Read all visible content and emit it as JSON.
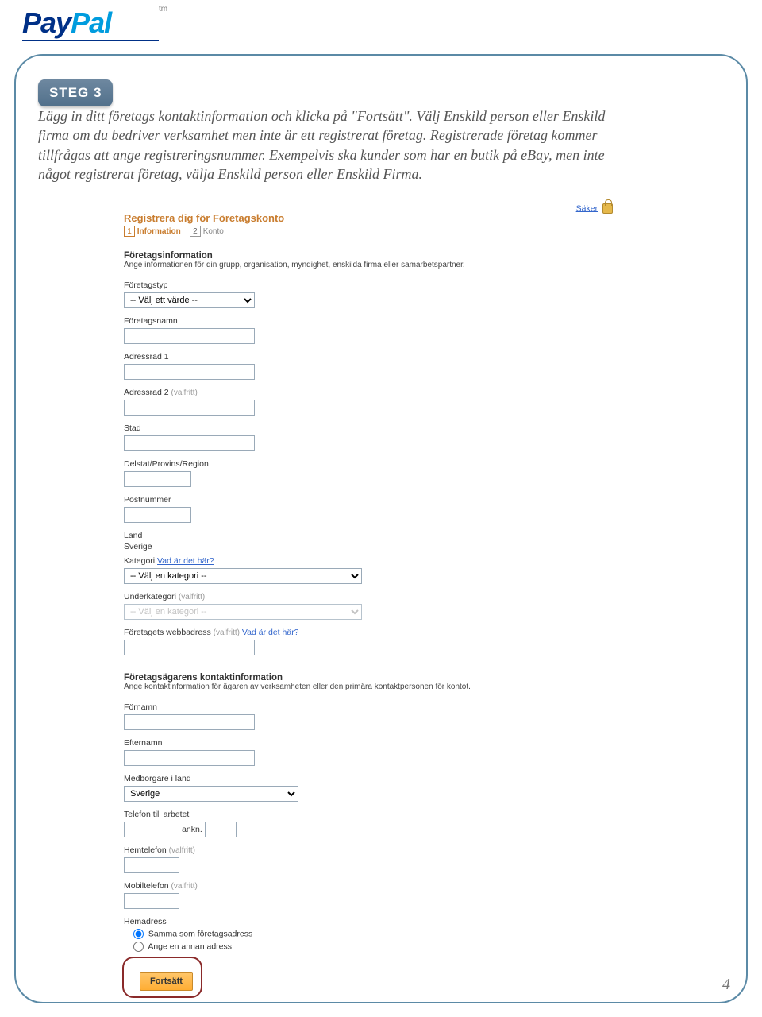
{
  "logo": {
    "part1": "Pay",
    "part2": "Pal",
    "tm": "tm"
  },
  "step_badge": "STEG 3",
  "intro": "Lägg in ditt företags kontaktinformation och klicka på \"Fortsätt\". Välj Enskild person eller Enskild firma om du bedriver verksamhet men inte är ett registrerat företag. Registrerade företag kommer tillfrågas att ange registreringsnummer. Exempelvis ska kunder som har en butik på eBay, men inte något registrerat företag, välja Enskild person eller Enskild Firma.",
  "form": {
    "title": "Registrera dig för Företagskonto",
    "secure_label": "Säker",
    "steps": {
      "n1": "1",
      "lbl1": "Information",
      "n2": "2",
      "lbl2": "Konto"
    },
    "company": {
      "heading": "Företagsinformation",
      "desc": "Ange informationen för din grupp, organisation, myndighet, enskilda firma eller samarbetspartner.",
      "type_label": "Företagstyp",
      "type_option": "-- Välj ett värde --",
      "name_label": "Företagsnamn",
      "addr1_label": "Adressrad 1",
      "addr2_label": "Adressrad 2",
      "addr2_opt": "(valfritt)",
      "city_label": "Stad",
      "region_label": "Delstat/Provins/Region",
      "postal_label": "Postnummer",
      "country_label": "Land",
      "country_value": "Sverige",
      "category_label": "Kategori",
      "category_help": "Vad är det här?",
      "category_option": "-- Välj en kategori --",
      "subcategory_label": "Underkategori",
      "subcategory_opt": "(valfritt)",
      "subcategory_option": "-- Välj en kategori --",
      "web_label": "Företagets webbadress",
      "web_opt": "(valfritt)",
      "web_help": "Vad är det här?"
    },
    "owner": {
      "heading": "Företagsägarens kontaktinformation",
      "desc": "Ange kontaktinformation för ägaren av verksamheten eller den primära kontaktpersonen för kontot.",
      "first_label": "Förnamn",
      "last_label": "Efternamn",
      "citizen_label": "Medborgare i land",
      "citizen_value": "Sverige",
      "workphone_label": "Telefon till arbetet",
      "ext_label": "ankn.",
      "homephone_label": "Hemtelefon",
      "homephone_opt": "(valfritt)",
      "mobile_label": "Mobiltelefon",
      "mobile_opt": "(valfritt)",
      "homeaddr_label": "Hemadress",
      "radio_same": "Samma som företagsadress",
      "radio_other": "Ange en annan adress",
      "continue": "Fortsätt"
    }
  },
  "page_number": "4"
}
